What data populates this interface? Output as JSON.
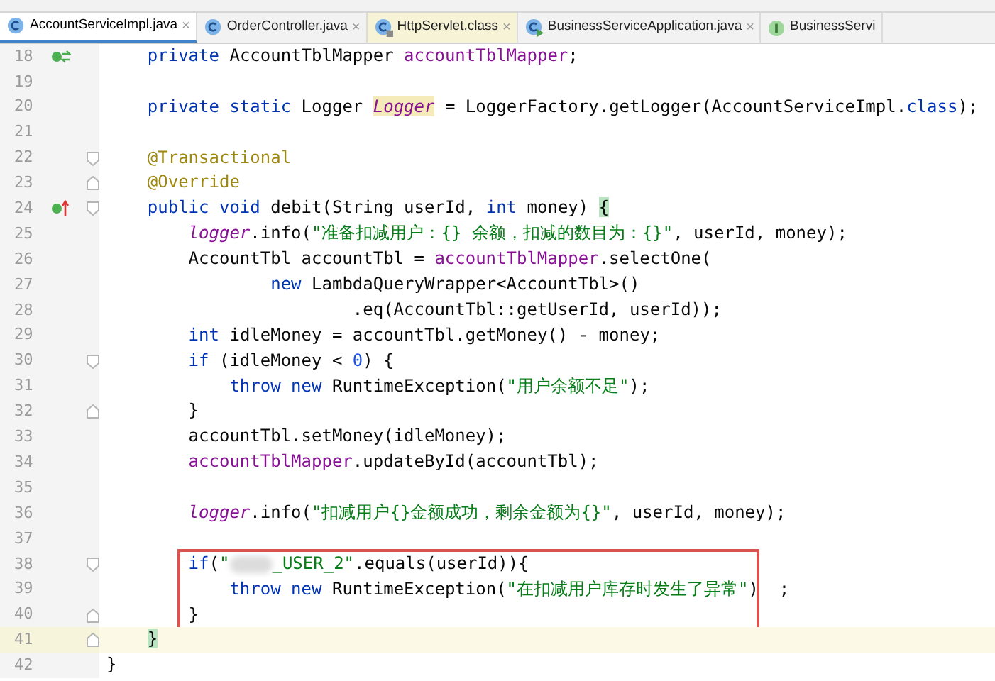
{
  "tabs": [
    {
      "label": "AccountServiceImpl.java",
      "kind": "class",
      "selected": true,
      "close": "×"
    },
    {
      "label": "OrderController.java",
      "kind": "class",
      "selected": false,
      "close": "×"
    },
    {
      "label": "HttpServlet.class",
      "kind": "library",
      "selected": false,
      "close": "×"
    },
    {
      "label": "BusinessServiceApplication.java",
      "kind": "application",
      "selected": false,
      "close": "×"
    },
    {
      "label": "BusinessServi",
      "kind": "interface",
      "selected": false
    }
  ],
  "lines": [
    {
      "number": "18",
      "gutter_icon": {
        "kind": "bean"
      },
      "current": false,
      "boxed": false,
      "tokens": [
        {
          "kind": "keyword",
          "text": "    private"
        },
        {
          "kind": "plain",
          "text": " AccountTblMapper "
        },
        {
          "kind": "field",
          "text": "accountTblMapper"
        },
        {
          "kind": "plain",
          "text": ";"
        }
      ]
    },
    {
      "number": "19",
      "current": false,
      "boxed": false
    },
    {
      "number": "20",
      "current": false,
      "boxed": false,
      "tokens": [
        {
          "kind": "keyword",
          "text": "    private static"
        },
        {
          "kind": "plain",
          "text": " Logger "
        },
        {
          "kind": "static-highlighted",
          "text": "Logger"
        },
        {
          "kind": "plain",
          "text": " = LoggerFactory.getLogger(AccountServiceImpl."
        },
        {
          "kind": "keyword",
          "text": "class"
        },
        {
          "kind": "plain",
          "text": ");"
        }
      ]
    },
    {
      "number": "21",
      "current": false,
      "boxed": false
    },
    {
      "number": "22",
      "fold": {
        "kind": "start"
      },
      "current": false,
      "boxed": false,
      "tokens": [
        {
          "kind": "annotation",
          "text": "    @Transactional"
        }
      ]
    },
    {
      "number": "23",
      "fold": {
        "kind": "end"
      },
      "current": false,
      "boxed": false,
      "tokens": [
        {
          "kind": "annotation",
          "text": "    @Override"
        }
      ]
    },
    {
      "number": "24",
      "gutter_icon": {
        "kind": "override"
      },
      "fold": {
        "kind": "start"
      },
      "current": false,
      "boxed": false,
      "tokens": [
        {
          "kind": "keyword",
          "text": "    public void"
        },
        {
          "kind": "plain",
          "text": " debit(String userId, "
        },
        {
          "kind": "keyword",
          "text": "int"
        },
        {
          "kind": "plain",
          "text": " money) "
        },
        {
          "kind": "brace-match",
          "text": "{"
        }
      ]
    },
    {
      "number": "25",
      "current": false,
      "boxed": false,
      "tokens": [
        {
          "kind": "static",
          "text": "        logger"
        },
        {
          "kind": "plain",
          "text": ".info("
        },
        {
          "kind": "string",
          "text": "\"准备扣减用户：{} 余额，扣减的数目为：{}\""
        },
        {
          "kind": "plain",
          "text": ", userId, money);"
        }
      ]
    },
    {
      "number": "26",
      "current": false,
      "boxed": false,
      "tokens": [
        {
          "kind": "plain",
          "text": "        AccountTbl accountTbl = "
        },
        {
          "kind": "field",
          "text": "accountTblMapper"
        },
        {
          "kind": "plain",
          "text": ".selectOne("
        }
      ]
    },
    {
      "number": "27",
      "current": false,
      "boxed": false,
      "tokens": [
        {
          "kind": "keyword",
          "text": "                new"
        },
        {
          "kind": "plain",
          "text": " LambdaQueryWrapper<AccountTbl>()"
        }
      ]
    },
    {
      "number": "28",
      "current": false,
      "boxed": false,
      "tokens": [
        {
          "kind": "plain",
          "text": "                        .eq(AccountTbl::getUserId, userId));"
        }
      ]
    },
    {
      "number": "29",
      "current": false,
      "boxed": false,
      "tokens": [
        {
          "kind": "keyword",
          "text": "        int"
        },
        {
          "kind": "plain",
          "text": " idleMoney = accountTbl.getMoney() - money;"
        }
      ]
    },
    {
      "number": "30",
      "fold": {
        "kind": "start"
      },
      "current": false,
      "boxed": false,
      "tokens": [
        {
          "kind": "keyword",
          "text": "        if"
        },
        {
          "kind": "plain",
          "text": " (idleMoney < "
        },
        {
          "kind": "number",
          "text": "0"
        },
        {
          "kind": "plain",
          "text": ") {"
        }
      ]
    },
    {
      "number": "31",
      "current": false,
      "boxed": false,
      "tokens": [
        {
          "kind": "keyword",
          "text": "            throw new"
        },
        {
          "kind": "plain",
          "text": " RuntimeException("
        },
        {
          "kind": "string",
          "text": "\"用户余额不足\""
        },
        {
          "kind": "plain",
          "text": ");"
        }
      ]
    },
    {
      "number": "32",
      "fold": {
        "kind": "end"
      },
      "current": false,
      "boxed": false,
      "tokens": [
        {
          "kind": "plain",
          "text": "        }"
        }
      ]
    },
    {
      "number": "33",
      "current": false,
      "boxed": false,
      "tokens": [
        {
          "kind": "plain",
          "text": "        accountTbl.setMoney(idleMoney);"
        }
      ]
    },
    {
      "number": "34",
      "current": false,
      "boxed": false,
      "tokens": [
        {
          "kind": "field",
          "text": "        accountTblMapper"
        },
        {
          "kind": "plain",
          "text": ".updateById(accountTbl);"
        }
      ]
    },
    {
      "number": "35",
      "current": false,
      "boxed": false
    },
    {
      "number": "36",
      "current": false,
      "boxed": false,
      "tokens": [
        {
          "kind": "static",
          "text": "        logger"
        },
        {
          "kind": "plain",
          "text": ".info("
        },
        {
          "kind": "string",
          "text": "\"扣减用户{}金额成功，剩余金额为{}\""
        },
        {
          "kind": "plain",
          "text": ", userId, money);"
        }
      ]
    },
    {
      "number": "37",
      "current": false,
      "boxed": false
    },
    {
      "number": "38",
      "fold": {
        "kind": "start"
      },
      "current": false,
      "boxed": true,
      "tokens": [
        {
          "kind": "keyword",
          "text": "        if"
        },
        {
          "kind": "plain",
          "text": "("
        },
        {
          "kind": "string",
          "text": "\""
        },
        {
          "kind": "redacted"
        },
        {
          "kind": "string",
          "text": "_USER_2\""
        },
        {
          "kind": "plain",
          "text": ".equals(userId)){"
        }
      ]
    },
    {
      "number": "39",
      "current": false,
      "boxed": true,
      "tokens": [
        {
          "kind": "keyword",
          "text": "            throw new"
        },
        {
          "kind": "plain",
          "text": " RuntimeException("
        },
        {
          "kind": "string",
          "text": "\"在扣减用户库存时发生了异常\""
        },
        {
          "kind": "plain",
          "text": ")  ;"
        }
      ]
    },
    {
      "number": "40",
      "fold": {
        "kind": "end"
      },
      "current": false,
      "boxed": true,
      "tokens": [
        {
          "kind": "plain",
          "text": "        }"
        }
      ]
    },
    {
      "number": "41",
      "fold": {
        "kind": "end"
      },
      "current": true,
      "boxed": false,
      "tokens": [
        {
          "kind": "brace-match",
          "text": "    }"
        }
      ]
    },
    {
      "number": "42",
      "current": false,
      "boxed": false,
      "tokens": [
        {
          "kind": "plain",
          "text": "}"
        }
      ]
    }
  ]
}
